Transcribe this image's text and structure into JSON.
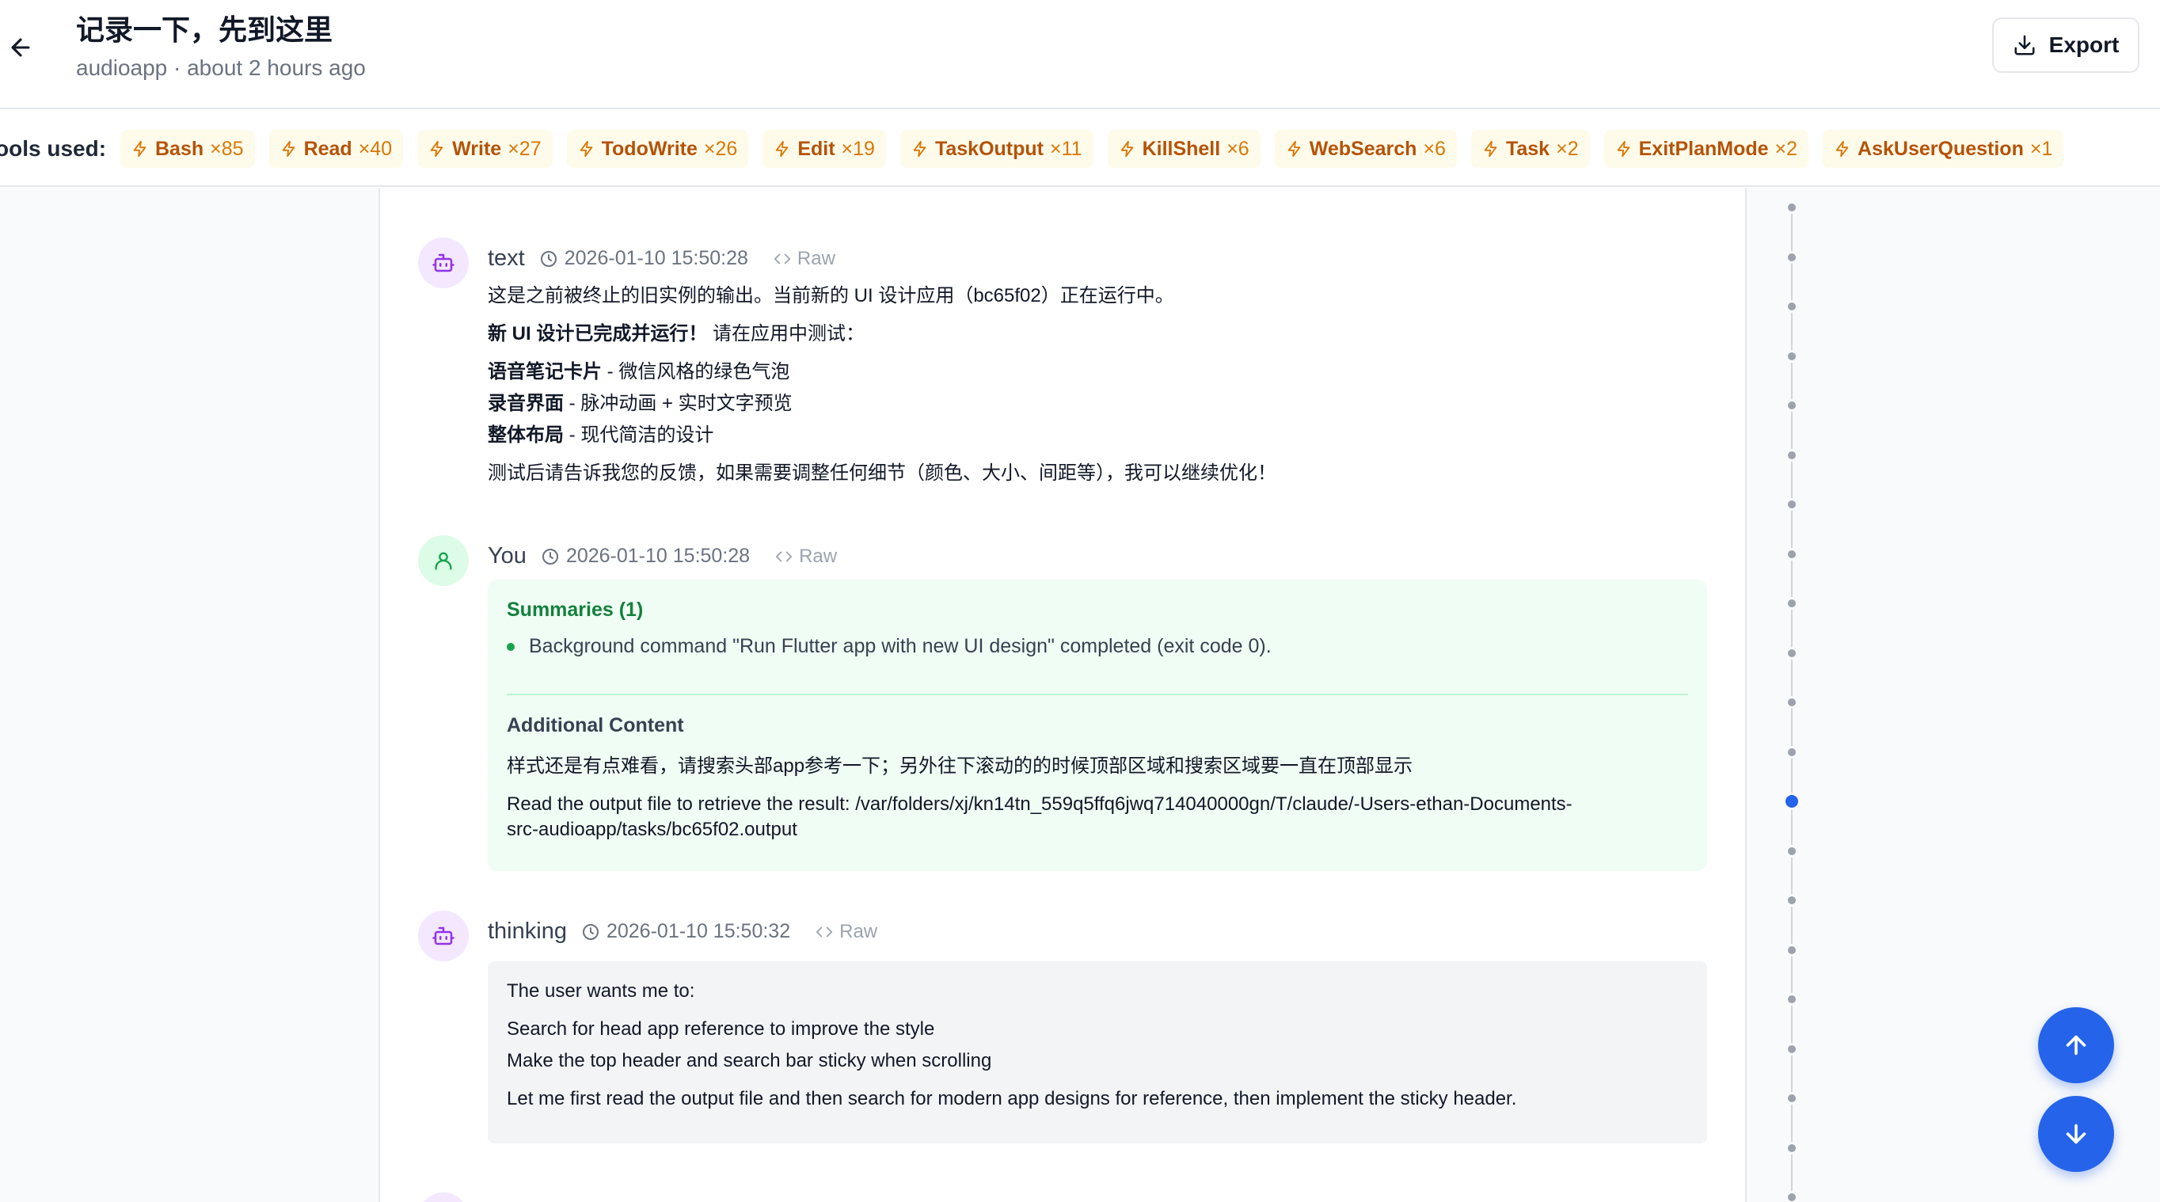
{
  "header": {
    "title": "记录一下，先到这里",
    "subtitle": "audioapp · about 2 hours ago",
    "export_label": "Export"
  },
  "tools": {
    "label": "ools used:",
    "items": [
      {
        "name": "Bash",
        "count": "×85"
      },
      {
        "name": "Read",
        "count": "×40"
      },
      {
        "name": "Write",
        "count": "×27"
      },
      {
        "name": "TodoWrite",
        "count": "×26"
      },
      {
        "name": "Edit",
        "count": "×19"
      },
      {
        "name": "TaskOutput",
        "count": "×11"
      },
      {
        "name": "KillShell",
        "count": "×6"
      },
      {
        "name": "WebSearch",
        "count": "×6"
      },
      {
        "name": "Task",
        "count": "×2"
      },
      {
        "name": "ExitPlanMode",
        "count": "×2"
      },
      {
        "name": "AskUserQuestion",
        "count": "×1"
      }
    ]
  },
  "messages": [
    {
      "role": "text",
      "timestamp": "2026-01-10 15:50:28",
      "raw_label": "Raw",
      "lines": [
        "这是之前被终止的旧实例的输出。当前新的 UI 设计应用（bc65f02）正在运行中。",
        "请在应用中测试：",
        "微信风格的绿色气泡",
        "脉冲动画 + 实时文字预览",
        "现代简洁的设计",
        "测试后请告诉我您的反馈，如果需要调整任何细节（颜色、大小、间距等），我可以继续优化！"
      ],
      "bold": [
        "新 UI 设计已完成并运行！",
        "语音笔记卡片",
        "录音界面",
        "整体布局"
      ],
      "dash": " - "
    },
    {
      "role": "You",
      "timestamp": "2026-01-10 15:50:28",
      "raw_label": "Raw",
      "summaries_title": "Summaries (1)",
      "summary_item": "Background command \"Run Flutter app with new UI design\" completed (exit code 0).",
      "additional_title": "Additional Content",
      "additional_line1": "样式还是有点难看，请搜索头部app参考一下；另外往下滚动的的时候顶部区域和搜索区域要一直在顶部显示",
      "additional_line2a": "Read the output file to retrieve the result: /var/folders/xj/kn14tn_559q5ffq6jwq714040000gn/T/claude/-Users-ethan-Documents-",
      "additional_line2b": "src-audioapp/tasks/bc65f02.output"
    },
    {
      "role": "thinking",
      "timestamp": "2026-01-10 15:50:32",
      "raw_label": "Raw",
      "lines": [
        "The user wants me to:",
        "Search for head app reference to improve the style",
        "Make the top header and search bar sticky when scrolling",
        "Let me first read the output file and then search for modern app designs for reference, then implement the sticky header."
      ]
    }
  ],
  "timeline": {
    "count": 21,
    "active_index": 12
  },
  "colors": {
    "accent": "#2563eb",
    "tool_chip_bg": "#fffbeb",
    "tool_chip_text": "#b45309",
    "bot_avatar_bg": "#f3e8ff",
    "user_avatar_bg": "#dcfce7",
    "summary_title": "#15803d"
  }
}
